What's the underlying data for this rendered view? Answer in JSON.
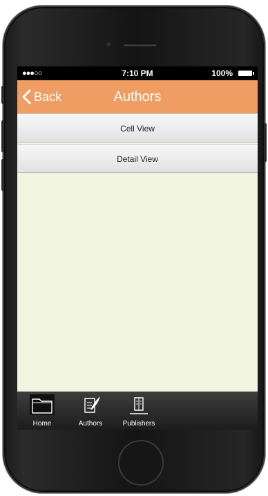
{
  "status_bar": {
    "signal": "●●●○○",
    "time": "7:10 PM",
    "battery": "100%"
  },
  "nav": {
    "back_label": "Back",
    "title": "Authors"
  },
  "list": {
    "items": [
      {
        "label": "Cell View"
      },
      {
        "label": "Detail View"
      }
    ]
  },
  "tabs": [
    {
      "label": "Home",
      "icon": "folder-icon"
    },
    {
      "label": "Authors",
      "icon": "quill-icon"
    },
    {
      "label": "Publishers",
      "icon": "book-icon"
    }
  ],
  "colors": {
    "nav_bar": "#ef9d62",
    "content_bg": "#f1f5df",
    "tab_bar": "#2a2a2a"
  }
}
